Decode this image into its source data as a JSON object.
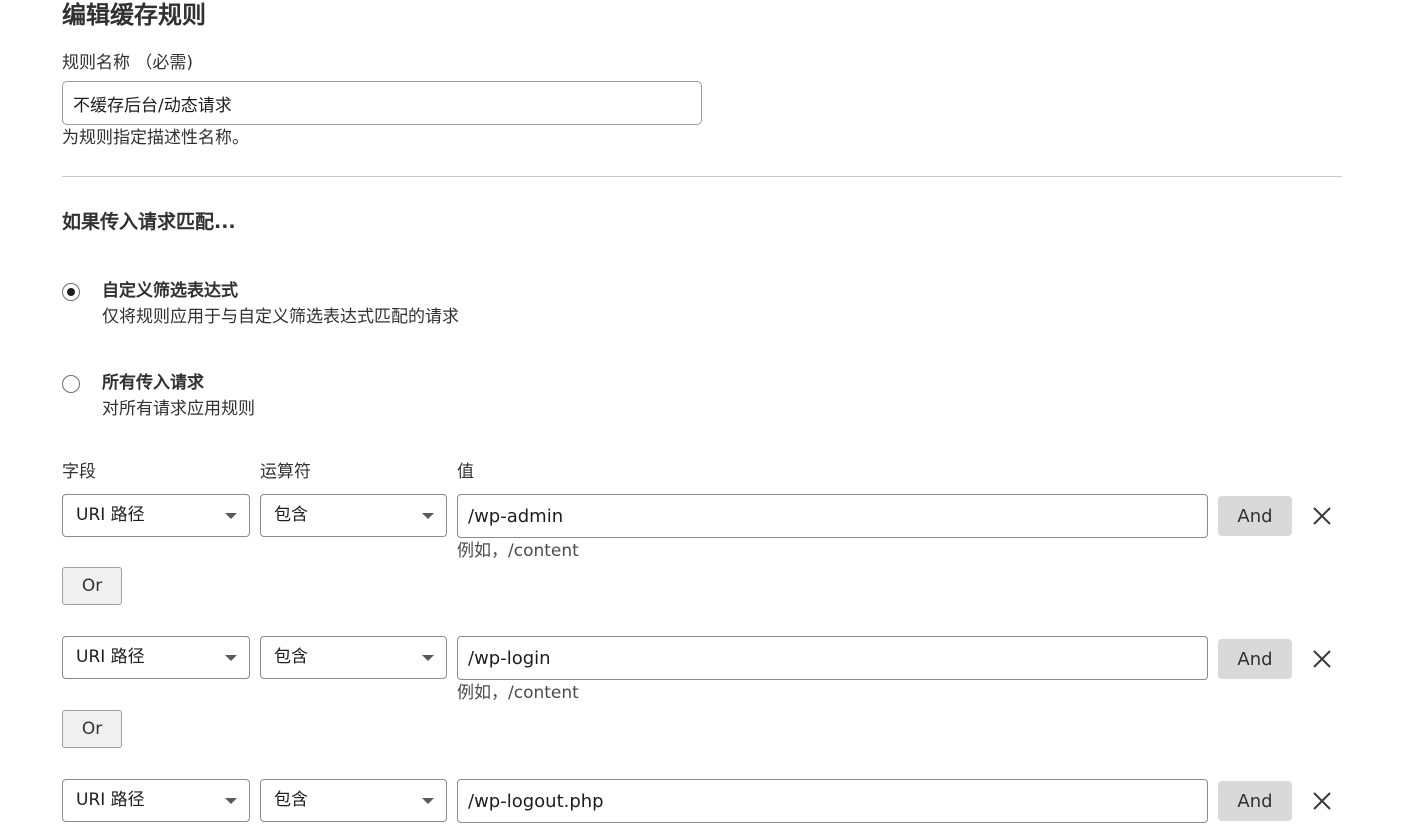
{
  "page": {
    "title": "编辑缓存规则"
  },
  "rule_name": {
    "label": "规则名称 （必需)",
    "value": "不缓存后台/动态请求",
    "helper": "为规则指定描述性名称。"
  },
  "match": {
    "heading": "如果传入请求匹配...",
    "options": [
      {
        "title": "自定义筛选表达式",
        "description": "仅将规则应用于与自定义筛选表达式匹配的请求",
        "selected": true
      },
      {
        "title": "所有传入请求",
        "description": "对所有请求应用规则",
        "selected": false
      }
    ]
  },
  "columns": {
    "field": "字段",
    "operator": "运算符",
    "value": "值"
  },
  "conditions": [
    {
      "field": "URI 路径",
      "operator": "包含",
      "value": "/wp-admin",
      "example": "例如，/content",
      "and_label": "And",
      "or_label": "Or"
    },
    {
      "field": "URI 路径",
      "operator": "包含",
      "value": "/wp-login",
      "example": "例如，/content",
      "and_label": "And",
      "or_label": "Or"
    },
    {
      "field": "URI 路径",
      "operator": "包含",
      "value": "/wp-logout.php",
      "example": "",
      "and_label": "And"
    }
  ],
  "icons": {
    "field_caret": "chevron-down-icon",
    "remove": "close-icon",
    "radio": "radio-icon"
  }
}
